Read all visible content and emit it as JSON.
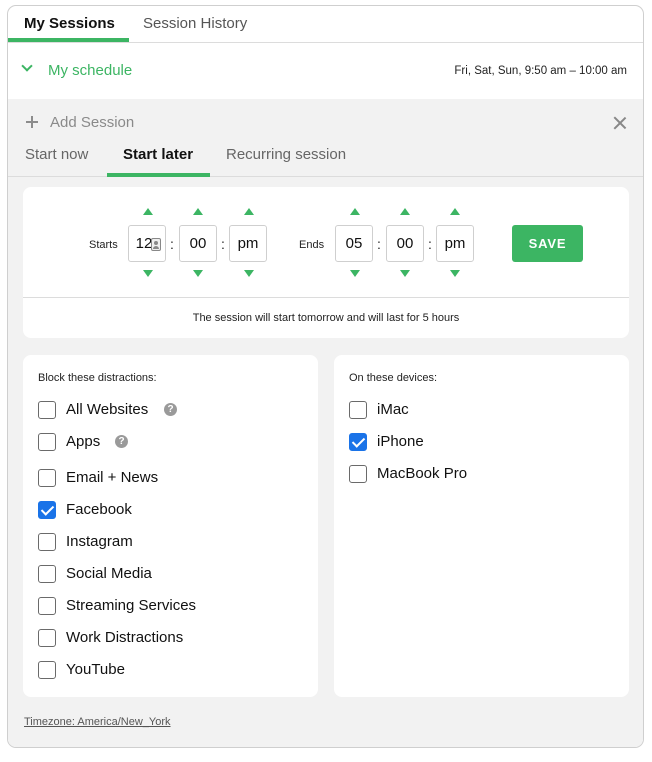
{
  "top_tabs": {
    "active": "My Sessions",
    "inactive": "Session History"
  },
  "schedule": {
    "label": "My schedule",
    "time": "Fri, Sat, Sun, 9:50 am – 10:00 am"
  },
  "add_session": {
    "label": "Add Session"
  },
  "session_tabs": [
    "Start now",
    "Start later",
    "Recurring session"
  ],
  "time_picker": {
    "starts_label": "Starts",
    "ends_label": "Ends",
    "start_hour": "12",
    "start_minute": "00",
    "start_ampm": "pm",
    "end_hour": "05",
    "end_minute": "00",
    "end_ampm": "pm",
    "separator": ":",
    "save_label": "SAVE",
    "info": "The session will start tomorrow and will last for 5 hours"
  },
  "block": {
    "heading": "Block these distractions:",
    "items": [
      {
        "label": "All Websites",
        "checked": false,
        "help": true
      },
      {
        "label": "Apps",
        "checked": false,
        "help": true
      },
      {
        "label": "Email + News",
        "checked": false
      },
      {
        "label": "Facebook",
        "checked": true
      },
      {
        "label": "Instagram",
        "checked": false
      },
      {
        "label": "Social Media",
        "checked": false
      },
      {
        "label": "Streaming Services",
        "checked": false
      },
      {
        "label": "Work Distractions",
        "checked": false
      },
      {
        "label": "YouTube",
        "checked": false
      }
    ]
  },
  "devices": {
    "heading": "On these devices:",
    "items": [
      {
        "label": "iMac",
        "checked": false
      },
      {
        "label": "iPhone",
        "checked": true
      },
      {
        "label": "MacBook Pro",
        "checked": false
      }
    ]
  },
  "timezone": "Timezone: America/New_York",
  "help_glyph": "?",
  "colors": {
    "accent": "#3cb563",
    "checkbox": "#1a73e8",
    "panel": "#f2f2f2"
  }
}
